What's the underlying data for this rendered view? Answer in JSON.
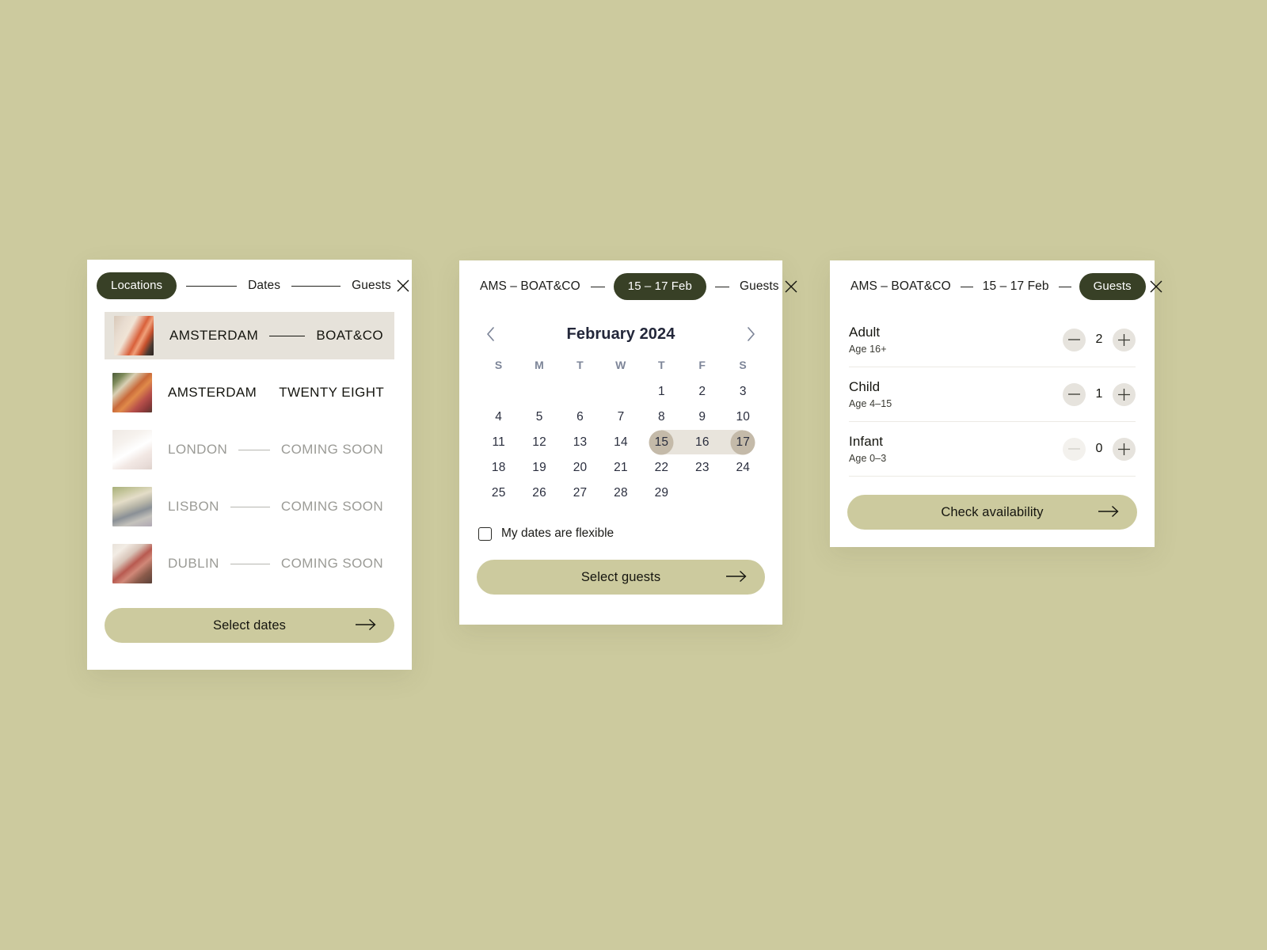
{
  "theme": {
    "background": "#ccca9e",
    "panel": "#ffffff",
    "pill_dark": "#384026",
    "cta": "#ccca9e",
    "selected_row": "#e6e2da",
    "range_band": "#e8e4dc",
    "range_endpoint": "#c4baa9",
    "weekday": "#7d8598",
    "day_number": "#2a2e3e",
    "muted_text": "#9b9b96"
  },
  "panel_locations": {
    "steps": {
      "active": "Locations",
      "dates": "Dates",
      "guests": "Guests"
    },
    "close_icon": "close-icon",
    "locations": [
      {
        "city": "AMSTERDAM",
        "property": "BOAT&CO",
        "state": "selected",
        "thumb": "thumb-1"
      },
      {
        "city": "AMSTERDAM",
        "property": "TWENTY EIGHT",
        "state": "available",
        "thumb": "thumb-2"
      },
      {
        "city": "LONDON",
        "property": "COMING SOON",
        "state": "soon",
        "thumb": "thumb-3"
      },
      {
        "city": "LISBON",
        "property": "COMING SOON",
        "state": "soon",
        "thumb": "thumb-4"
      },
      {
        "city": "DUBLIN",
        "property": "COMING SOON",
        "state": "soon",
        "thumb": "thumb-5"
      }
    ],
    "cta_label": "Select dates",
    "cta_arrow_icon": "arrow-right-icon"
  },
  "panel_dates": {
    "steps": {
      "location": "AMS – BOAT&CO",
      "active_dates": "15 – 17 Feb",
      "guests": "Guests"
    },
    "close_icon": "close-icon",
    "calendar": {
      "prev_icon": "chevron-left-icon",
      "next_icon": "chevron-right-icon",
      "title": "February 2024",
      "weekdays": [
        "S",
        "M",
        "T",
        "W",
        "T",
        "F",
        "S"
      ],
      "lead_blanks": 4,
      "days": [
        1,
        2,
        3,
        4,
        5,
        6,
        7,
        8,
        9,
        10,
        11,
        12,
        13,
        14,
        15,
        16,
        17,
        18,
        19,
        20,
        21,
        22,
        23,
        24,
        25,
        26,
        27,
        28,
        29
      ],
      "range_start": 15,
      "range_end": 17
    },
    "flexible_label": "My dates are flexible",
    "flexible_checked": false,
    "cta_label": "Select guests",
    "cta_arrow_icon": "arrow-right-icon"
  },
  "panel_guests": {
    "steps": {
      "location": "AMS – BOAT&CO",
      "dates": "15 – 17 Feb",
      "active_guests": "Guests"
    },
    "close_icon": "close-icon",
    "rows": [
      {
        "title": "Adult",
        "age": "Age 16+",
        "count": "2",
        "minus_disabled": false
      },
      {
        "title": "Child",
        "age": "Age 4–15",
        "count": "1",
        "minus_disabled": false
      },
      {
        "title": "Infant",
        "age": "Age 0–3",
        "count": "0",
        "minus_disabled": true
      }
    ],
    "minus_icon": "minus-icon",
    "plus_icon": "plus-icon",
    "cta_label": "Check availability",
    "cta_arrow_icon": "arrow-right-icon"
  }
}
